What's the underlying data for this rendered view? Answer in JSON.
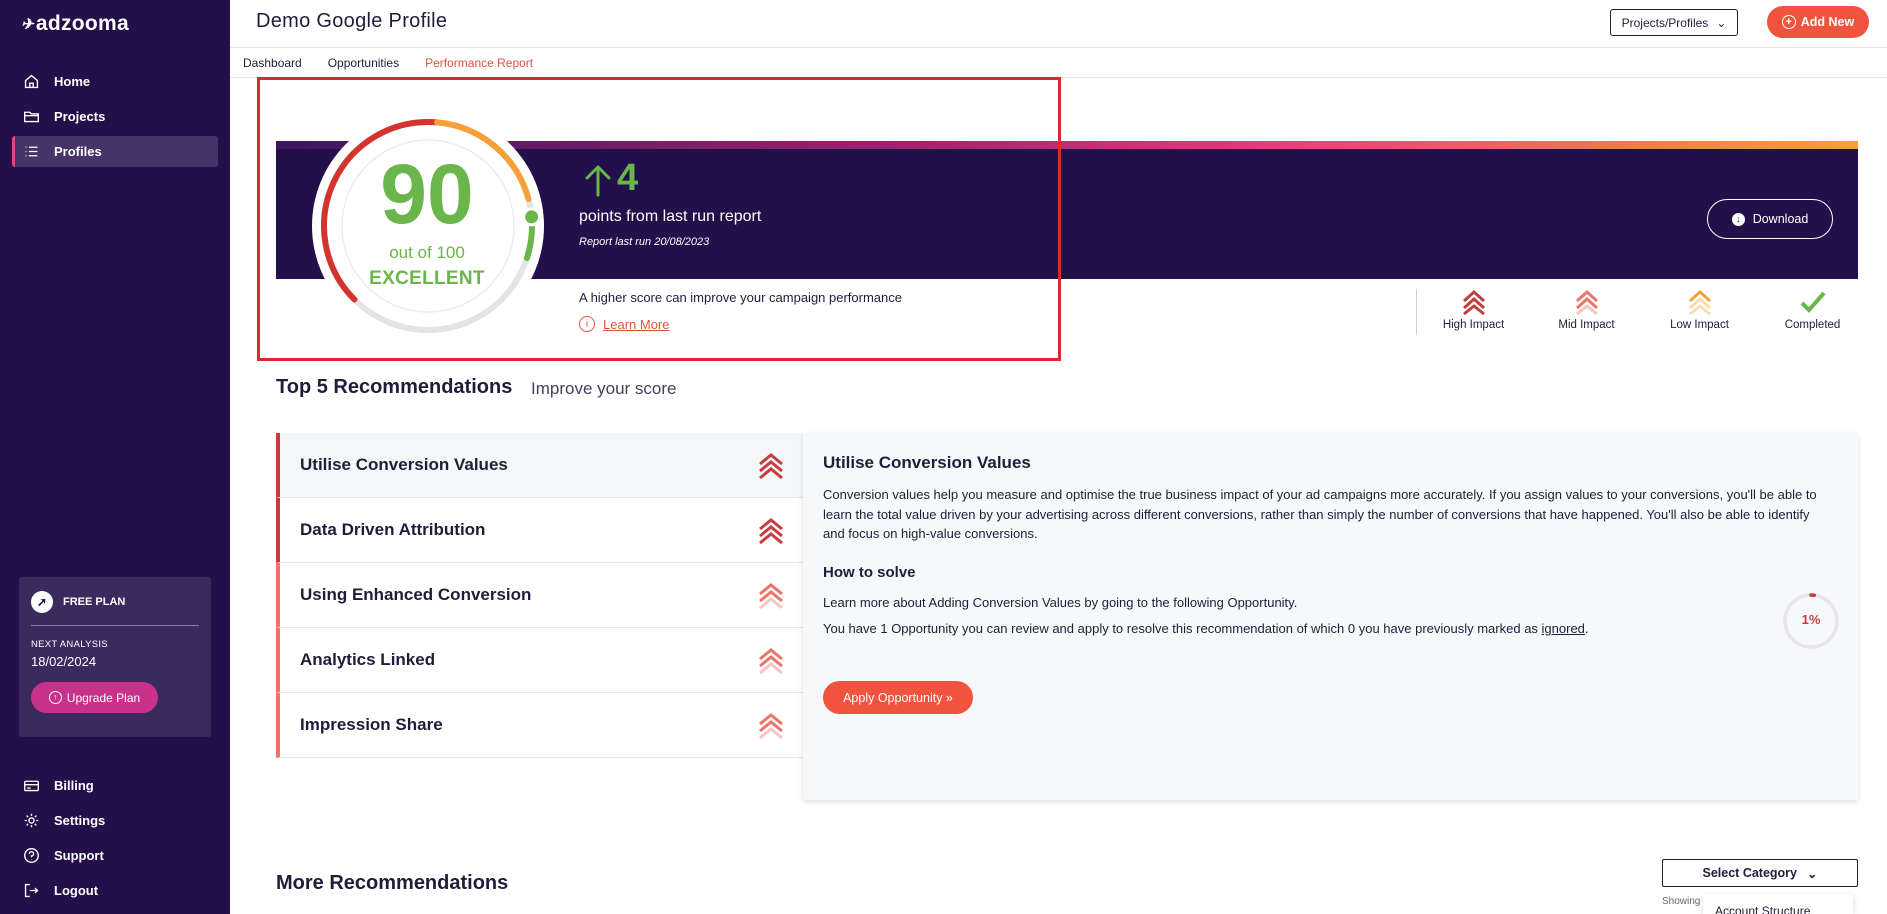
{
  "app": {
    "logo_text": "adzooma"
  },
  "sidebar": {
    "top_items": [
      {
        "label": "Home",
        "icon": "home-icon"
      },
      {
        "label": "Projects",
        "icon": "folder-icon"
      },
      {
        "label": "Profiles",
        "icon": "list-icon",
        "active": true
      }
    ],
    "plan": {
      "name": "FREE PLAN",
      "next_label": "NEXT ANALYSIS",
      "next_date": "18/02/2024",
      "upgrade_label": "Upgrade Plan"
    },
    "bottom_items": [
      {
        "label": "Billing",
        "icon": "billing-icon"
      },
      {
        "label": "Settings",
        "icon": "gear-icon"
      },
      {
        "label": "Support",
        "icon": "help-icon"
      },
      {
        "label": "Logout",
        "icon": "logout-icon"
      }
    ]
  },
  "header": {
    "title": "Demo Google Profile",
    "projects_select": "Projects/Profiles",
    "add_new": "Add New"
  },
  "tabs": [
    {
      "label": "Dashboard"
    },
    {
      "label": "Opportunities"
    },
    {
      "label": "Performance Report",
      "active": true
    }
  ],
  "score": {
    "value": "90",
    "out_of": "out of 100",
    "rating": "EXCELLENT",
    "fraction": 0.9,
    "delta": "4",
    "points_text": "points from last run report",
    "last_run": "Report last run 20/08/2023",
    "download": "Download",
    "higher_text": "A higher score can improve your campaign performance",
    "learn_more": "Learn More"
  },
  "legend": [
    {
      "label": "High Impact",
      "color": "#c33f3f"
    },
    {
      "label": "Mid Impact",
      "color": "#e8766a"
    },
    {
      "label": "Low Impact",
      "color": "#f4a13a"
    },
    {
      "label": "Completed",
      "color": "#6ab64a"
    }
  ],
  "top5": {
    "title": "Top 5 Recommendations",
    "subtitle": "Improve your score",
    "items": [
      {
        "label": "Utilise Conversion Values",
        "impact": "high"
      },
      {
        "label": "Data Driven Attribution",
        "impact": "high"
      },
      {
        "label": "Using Enhanced Conversion",
        "impact": "mid"
      },
      {
        "label": "Analytics Linked",
        "impact": "mid"
      },
      {
        "label": "Impression Share",
        "impact": "mid"
      }
    ]
  },
  "detail": {
    "title": "Utilise Conversion Values",
    "description": "Conversion values help you measure and optimise the true business impact of your ad campaigns more accurately. If you assign values to your conversions, you'll be able to learn the total value driven by your advertising across different conversions, rather than simply the number of conversions that have happened. You'll also be able to identify and focus on high-value conversions.",
    "how_to_solve": "How to solve",
    "line1": "Learn more about Adding Conversion Values by going to the following Opportunity.",
    "line2_prefix": "You have 1 Opportunity you can review and apply to resolve this recommendation of which 0 you have previously marked as ",
    "line2_link": "ignored",
    "line2_suffix": ".",
    "progress": "1%",
    "progress_fraction": 0.01,
    "apply": "Apply Opportunity »"
  },
  "more": {
    "title": "More Recommendations",
    "select_category": "Select Category",
    "showing": "Showing",
    "dropdown_first": "Account Structure"
  }
}
